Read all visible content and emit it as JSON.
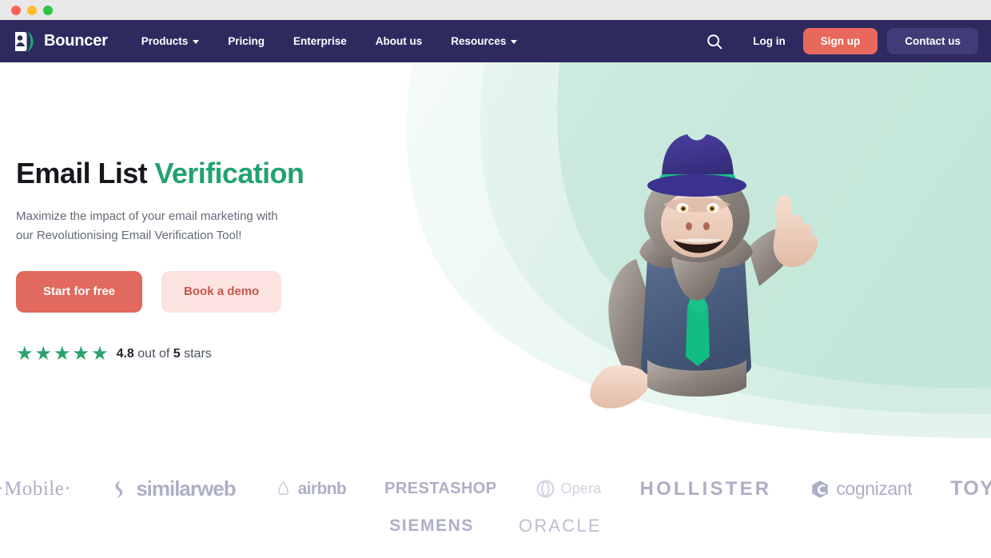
{
  "window": {
    "traffic_lights": [
      "close",
      "minimize",
      "maximize"
    ],
    "colors": {
      "close": "#ff5f57",
      "minimize": "#febc2e",
      "maximize": "#28c840",
      "titlebar_bg": "#e8e8e8"
    }
  },
  "navbar": {
    "brand_name": "Bouncer",
    "brand_icon": "bouncer-logo-icon",
    "bg_color": "#2e2a60",
    "links": [
      {
        "label": "Products",
        "has_dropdown": true
      },
      {
        "label": "Pricing",
        "has_dropdown": false
      },
      {
        "label": "Enterprise",
        "has_dropdown": false
      },
      {
        "label": "About us",
        "has_dropdown": false
      },
      {
        "label": "Resources",
        "has_dropdown": true
      }
    ],
    "search_icon": "search-icon",
    "login_label": "Log in",
    "signup_label": "Sign up",
    "signup_color": "#e8695c",
    "contact_label": "Contact us",
    "contact_color": "#413c77"
  },
  "hero": {
    "title_plain": "Email List ",
    "title_accent": "Verification",
    "accent_color": "#22a36d",
    "subtitle_line1": "Maximize the impact of your email marketing with",
    "subtitle_line2": "our Revolutionising Email Verification Tool!",
    "primary_cta": "Start for free",
    "primary_cta_color": "#e2695d",
    "secondary_cta": "Book a demo",
    "secondary_cta_color": "#fbe3df",
    "rating": {
      "stars_filled": 5,
      "star_glyph": "★",
      "star_color": "#2aa26c",
      "score": "4.8",
      "middle_text": " out of ",
      "max": "5",
      "suffix": " stars"
    },
    "illustration": "gorilla-mascot-illustration",
    "background_shape": "nested-green-arcs",
    "background_colors": [
      "#c3e8da",
      "#d9efe6",
      "#edf8f3"
    ]
  },
  "logo_strip": {
    "row1": [
      {
        "name": "t-mobile-logo",
        "label": "·T· · ·Mobile·"
      },
      {
        "name": "similarweb-logo",
        "label": "similarweb"
      },
      {
        "name": "airbnb-logo",
        "label": "airbnb"
      },
      {
        "name": "prestashop-logo",
        "label": "PRESTASHOP"
      },
      {
        "name": "opera-logo",
        "label": "Opera"
      },
      {
        "name": "hollister-logo",
        "label": "HOLLISTER"
      },
      {
        "name": "cognizant-logo",
        "label": "cognizant"
      },
      {
        "name": "toyota-logo",
        "label": "TOYOTA"
      }
    ],
    "row2": [
      {
        "name": "siemens-logo",
        "label": "SIEMENS"
      },
      {
        "name": "oracle-logo",
        "label": "ORACLE"
      }
    ],
    "logo_color": "#a9abc4"
  }
}
